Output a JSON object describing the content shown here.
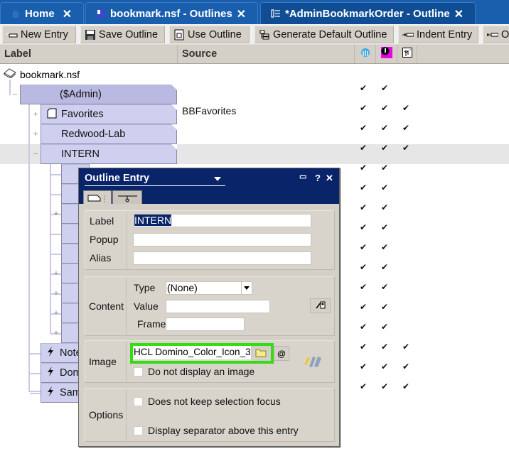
{
  "tabs": [
    {
      "label": "Home",
      "icon": "home-icon",
      "close": "✕"
    },
    {
      "label": "bookmark.nsf - Outlines",
      "icon": "database-icon",
      "close": "✕"
    },
    {
      "label": "*AdminBookmarkOrder - Outline",
      "icon": "outline-icon",
      "close": "✕"
    }
  ],
  "toolbar": {
    "new_entry": "New Entry",
    "save_outline": "Save Outline",
    "use_outline": "Use Outline",
    "generate_default": "Generate Default Outline",
    "indent_entry": "Indent Entry",
    "outdent_entry": "O"
  },
  "columns": {
    "label": "Label",
    "source": "Source",
    "icon_cols": [
      "notes-client-icon",
      "web-browser-icon",
      "mobile-icon"
    ]
  },
  "tree": {
    "root": "bookmark.nsf",
    "admin": "($Admin)",
    "items": [
      {
        "label": "Favorites",
        "source": "BBFavorites",
        "checks": [
          true,
          true,
          true
        ],
        "expander": "+"
      },
      {
        "label": "Redwood-Lab",
        "source": "",
        "checks": [
          true,
          true,
          true
        ],
        "expander": "+"
      },
      {
        "label": "INTERN",
        "source": "",
        "checks": [
          true,
          true,
          true
        ],
        "expander": "−",
        "selected": true
      }
    ],
    "admin_checks": [
      true,
      true,
      false
    ],
    "intern_children_checks": [
      [
        true,
        true
      ],
      [
        true,
        true
      ],
      [
        true,
        true
      ],
      [
        true,
        true
      ],
      [
        true,
        true
      ],
      [
        true,
        true
      ],
      [
        true,
        true
      ],
      [
        true,
        true
      ],
      [
        true,
        true
      ]
    ],
    "action_items": [
      {
        "label": "Note",
        "checks": [
          true,
          true,
          true
        ]
      },
      {
        "label": "Dom",
        "checks": [
          true,
          true,
          true
        ]
      },
      {
        "label": "Sam",
        "checks": [
          true,
          true,
          true
        ]
      }
    ],
    "check_glyph": "✔"
  },
  "dialog": {
    "title": "Outline Entry",
    "controls": {
      "minimize": "▭",
      "help": "?",
      "close": "✕"
    },
    "basics": {
      "label_label": "Label",
      "label_value": "INTERN",
      "popup_label": "Popup",
      "popup_value": "",
      "alias_label": "Alias",
      "alias_value": ""
    },
    "content": {
      "section": "Content",
      "type_label": "Type",
      "type_value": "(None)",
      "value_label": "Value",
      "value_value": "",
      "frame_label": "Frame",
      "frame_value": ""
    },
    "image": {
      "section": "Image",
      "value": "HCL Domino_Color_Icon_3",
      "at_button": "@",
      "no_image_label": "Do not display an image",
      "no_image_checked": false
    },
    "options": {
      "section": "Options",
      "no_focus_label": "Does not keep selection focus",
      "no_focus_checked": false,
      "separator_label": "Display separator above this entry",
      "separator_checked": false
    },
    "highlight_color": "#33dd11"
  }
}
